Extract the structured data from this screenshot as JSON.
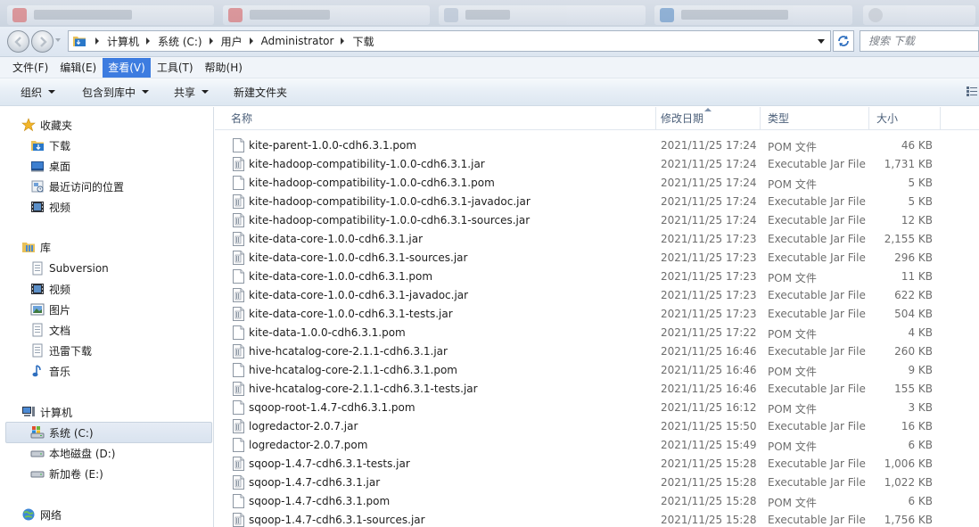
{
  "colors": {
    "menu_active": "#3d7ce0",
    "header_text": "#4c607a",
    "meta_text": "#6d6d6d"
  },
  "address": {
    "crumbs": [
      "计算机",
      "系统 (C:)",
      "用户",
      "Administrator",
      "下载"
    ]
  },
  "search": {
    "placeholder": "搜索 下载"
  },
  "menubar": {
    "items": [
      {
        "label": "文件(F)"
      },
      {
        "label": "编辑(E)"
      },
      {
        "label": "查看(V)",
        "active": true
      },
      {
        "label": "工具(T)"
      },
      {
        "label": "帮助(H)"
      }
    ]
  },
  "commandbar": {
    "organize": "组织",
    "include_library": "包含到库中",
    "share": "共享",
    "new_folder": "新建文件夹"
  },
  "navpane": {
    "favorites": {
      "label": "收藏夹",
      "icon": "star-icon"
    },
    "favorites_items": [
      {
        "label": "下载",
        "icon": "download-folder-icon"
      },
      {
        "label": "桌面",
        "icon": "desktop-icon"
      },
      {
        "label": "最近访问的位置",
        "icon": "recent-places-icon"
      },
      {
        "label": "视频",
        "icon": "video-icon"
      }
    ],
    "libraries": {
      "label": "库",
      "icon": "library-icon"
    },
    "library_items": [
      {
        "label": "Subversion",
        "icon": "document-icon"
      },
      {
        "label": "视频",
        "icon": "video-icon"
      },
      {
        "label": "图片",
        "icon": "picture-icon"
      },
      {
        "label": "文档",
        "icon": "document-icon"
      },
      {
        "label": "迅雷下载",
        "icon": "document-icon"
      },
      {
        "label": "音乐",
        "icon": "music-icon"
      }
    ],
    "computer": {
      "label": "计算机",
      "icon": "computer-icon"
    },
    "computer_items": [
      {
        "label": "系统 (C:)",
        "icon": "system-drive-icon",
        "selected": true
      },
      {
        "label": "本地磁盘 (D:)",
        "icon": "drive-icon"
      },
      {
        "label": "新加卷 (E:)",
        "icon": "drive-icon"
      }
    ],
    "network": {
      "label": "网络",
      "icon": "network-icon"
    }
  },
  "columns": {
    "name": "名称",
    "date": "修改日期",
    "type": "类型",
    "size": "大小"
  },
  "files": [
    {
      "name": "kite-parent-1.0.0-cdh6.3.1.pom",
      "date": "2021/11/25 17:24",
      "type": "POM 文件",
      "size": "46 KB",
      "kind": "pom"
    },
    {
      "name": "kite-hadoop-compatibility-1.0.0-cdh6.3.1.jar",
      "date": "2021/11/25 17:24",
      "type": "Executable Jar File",
      "size": "1,731 KB",
      "kind": "jar"
    },
    {
      "name": "kite-hadoop-compatibility-1.0.0-cdh6.3.1.pom",
      "date": "2021/11/25 17:24",
      "type": "POM 文件",
      "size": "5 KB",
      "kind": "pom"
    },
    {
      "name": "kite-hadoop-compatibility-1.0.0-cdh6.3.1-javadoc.jar",
      "date": "2021/11/25 17:24",
      "type": "Executable Jar File",
      "size": "5 KB",
      "kind": "jar"
    },
    {
      "name": "kite-hadoop-compatibility-1.0.0-cdh6.3.1-sources.jar",
      "date": "2021/11/25 17:24",
      "type": "Executable Jar File",
      "size": "12 KB",
      "kind": "jar"
    },
    {
      "name": "kite-data-core-1.0.0-cdh6.3.1.jar",
      "date": "2021/11/25 17:23",
      "type": "Executable Jar File",
      "size": "2,155 KB",
      "kind": "jar"
    },
    {
      "name": "kite-data-core-1.0.0-cdh6.3.1-sources.jar",
      "date": "2021/11/25 17:23",
      "type": "Executable Jar File",
      "size": "296 KB",
      "kind": "jar"
    },
    {
      "name": "kite-data-core-1.0.0-cdh6.3.1.pom",
      "date": "2021/11/25 17:23",
      "type": "POM 文件",
      "size": "11 KB",
      "kind": "pom"
    },
    {
      "name": "kite-data-core-1.0.0-cdh6.3.1-javadoc.jar",
      "date": "2021/11/25 17:23",
      "type": "Executable Jar File",
      "size": "622 KB",
      "kind": "jar"
    },
    {
      "name": "kite-data-core-1.0.0-cdh6.3.1-tests.jar",
      "date": "2021/11/25 17:23",
      "type": "Executable Jar File",
      "size": "504 KB",
      "kind": "jar"
    },
    {
      "name": "kite-data-1.0.0-cdh6.3.1.pom",
      "date": "2021/11/25 17:22",
      "type": "POM 文件",
      "size": "4 KB",
      "kind": "pom"
    },
    {
      "name": "hive-hcatalog-core-2.1.1-cdh6.3.1.jar",
      "date": "2021/11/25 16:46",
      "type": "Executable Jar File",
      "size": "260 KB",
      "kind": "jar"
    },
    {
      "name": "hive-hcatalog-core-2.1.1-cdh6.3.1.pom",
      "date": "2021/11/25 16:46",
      "type": "POM 文件",
      "size": "9 KB",
      "kind": "pom"
    },
    {
      "name": "hive-hcatalog-core-2.1.1-cdh6.3.1-tests.jar",
      "date": "2021/11/25 16:46",
      "type": "Executable Jar File",
      "size": "155 KB",
      "kind": "jar"
    },
    {
      "name": "sqoop-root-1.4.7-cdh6.3.1.pom",
      "date": "2021/11/25 16:12",
      "type": "POM 文件",
      "size": "3 KB",
      "kind": "pom"
    },
    {
      "name": "logredactor-2.0.7.jar",
      "date": "2021/11/25 15:50",
      "type": "Executable Jar File",
      "size": "16 KB",
      "kind": "jar"
    },
    {
      "name": "logredactor-2.0.7.pom",
      "date": "2021/11/25 15:49",
      "type": "POM 文件",
      "size": "6 KB",
      "kind": "pom"
    },
    {
      "name": "sqoop-1.4.7-cdh6.3.1-tests.jar",
      "date": "2021/11/25 15:28",
      "type": "Executable Jar File",
      "size": "1,006 KB",
      "kind": "jar"
    },
    {
      "name": "sqoop-1.4.7-cdh6.3.1.jar",
      "date": "2021/11/25 15:28",
      "type": "Executable Jar File",
      "size": "1,022 KB",
      "kind": "jar"
    },
    {
      "name": "sqoop-1.4.7-cdh6.3.1.pom",
      "date": "2021/11/25 15:28",
      "type": "POM 文件",
      "size": "6 KB",
      "kind": "pom"
    },
    {
      "name": "sqoop-1.4.7-cdh6.3.1-sources.jar",
      "date": "2021/11/25 15:28",
      "type": "Executable Jar File",
      "size": "1,756 KB",
      "kind": "jar"
    }
  ]
}
